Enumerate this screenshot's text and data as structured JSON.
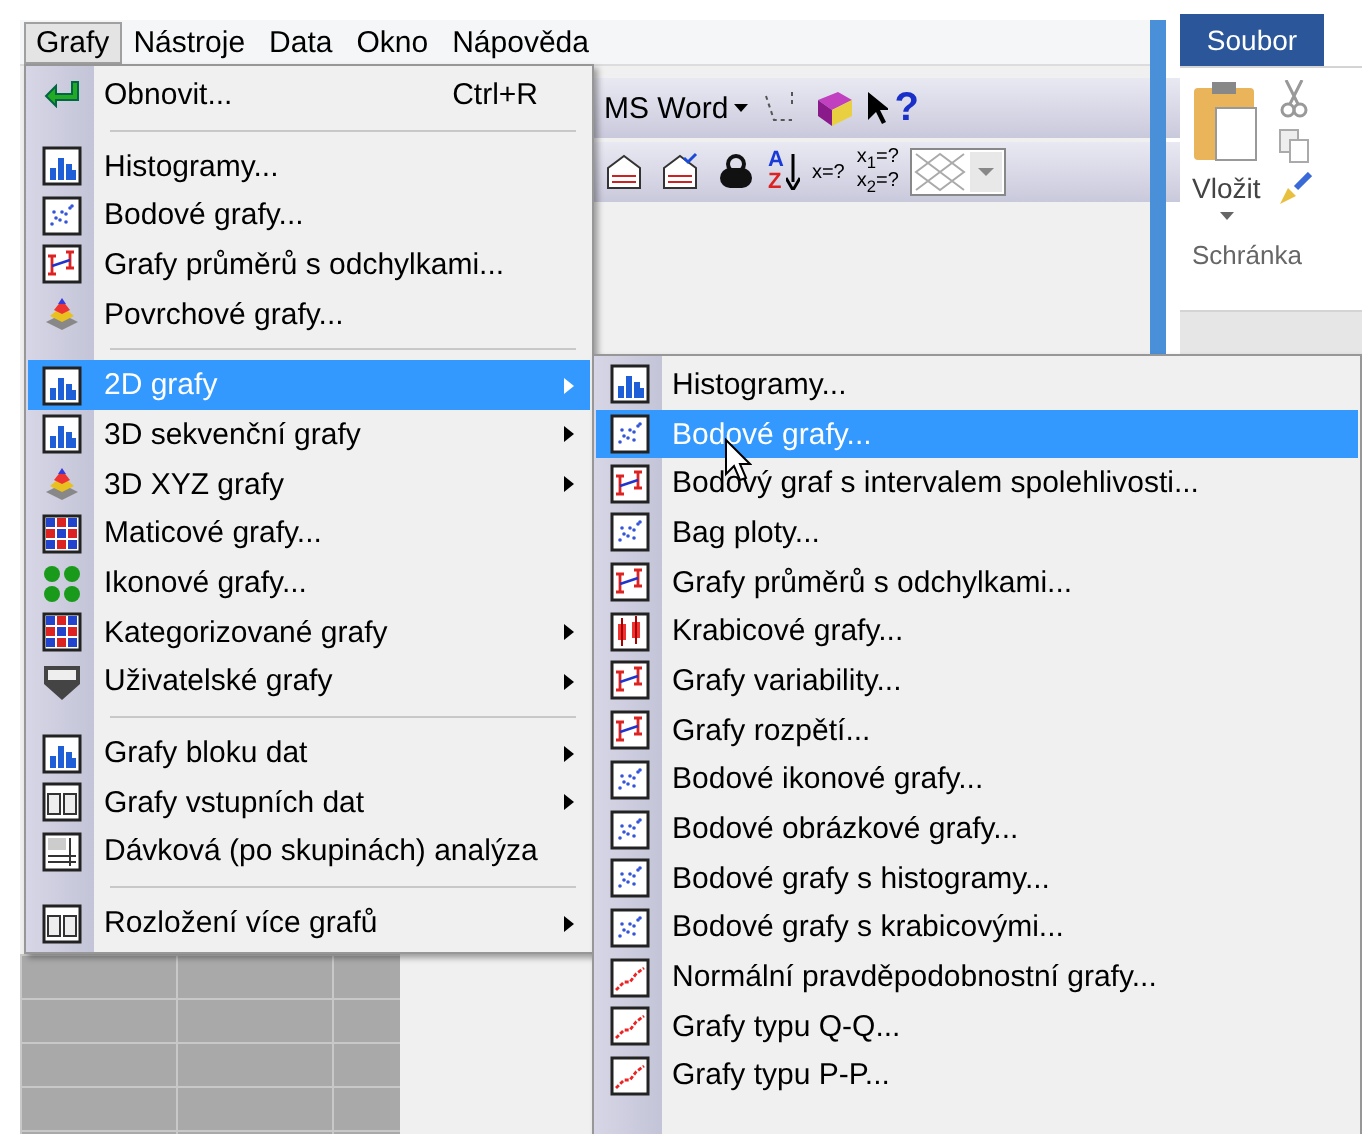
{
  "menubar": [
    {
      "label": "Grafy",
      "selected": true
    },
    {
      "label": "Nástroje",
      "selected": false
    },
    {
      "label": "Data",
      "selected": false
    },
    {
      "label": "Okno",
      "selected": false
    },
    {
      "label": "Nápověda",
      "selected": false
    }
  ],
  "toolbar": {
    "dropdown_label": "MS Word",
    "help_glyph": "?",
    "sort_letters": [
      "A",
      "Z"
    ],
    "formula_labels": [
      "x=?",
      "x$_{1}$=?",
      "x$_{2}$=?"
    ]
  },
  "ribbon": {
    "tab": "Soubor",
    "paste_label": "Vložit",
    "group_label": "Schránka"
  },
  "main_menu": [
    {
      "kind": "item",
      "label": "Obnovit...",
      "shortcut": "Ctrl+R",
      "submenu": false,
      "selected": false
    },
    {
      "kind": "separator"
    },
    {
      "kind": "item",
      "label": "Histogramy...",
      "submenu": false,
      "selected": false
    },
    {
      "kind": "item",
      "label": "Bodové grafy...",
      "submenu": false,
      "selected": false
    },
    {
      "kind": "item",
      "label": "Grafy průměrů s odchylkami...",
      "submenu": false,
      "selected": false
    },
    {
      "kind": "item",
      "label": "Povrchové grafy...",
      "submenu": false,
      "selected": false
    },
    {
      "kind": "separator"
    },
    {
      "kind": "item",
      "label": "2D grafy",
      "submenu": true,
      "selected": true
    },
    {
      "kind": "item",
      "label": "3D sekvenční grafy",
      "submenu": true,
      "selected": false
    },
    {
      "kind": "item",
      "label": "3D XYZ grafy",
      "submenu": true,
      "selected": false
    },
    {
      "kind": "item",
      "label": "Maticové grafy...",
      "submenu": false,
      "selected": false
    },
    {
      "kind": "item",
      "label": "Ikonové grafy...",
      "submenu": false,
      "selected": false
    },
    {
      "kind": "item",
      "label": "Kategorizované grafy",
      "submenu": true,
      "selected": false
    },
    {
      "kind": "item",
      "label": "Uživatelské grafy",
      "submenu": true,
      "selected": false
    },
    {
      "kind": "separator"
    },
    {
      "kind": "item",
      "label": "Grafy bloku dat",
      "submenu": true,
      "selected": false
    },
    {
      "kind": "item",
      "label": "Grafy vstupních dat",
      "submenu": true,
      "selected": false
    },
    {
      "kind": "item",
      "label": "Dávková (po skupinách) analýza",
      "submenu": false,
      "selected": false
    },
    {
      "kind": "separator"
    },
    {
      "kind": "item",
      "label": "Rozložení více grafů",
      "submenu": true,
      "selected": false
    }
  ],
  "submenu": [
    {
      "kind": "item",
      "label": "Histogramy...",
      "selected": false
    },
    {
      "kind": "item",
      "label": "Bodové grafy...",
      "selected": true
    },
    {
      "kind": "item",
      "label": "Bodový graf s intervalem spolehlivosti...",
      "selected": false
    },
    {
      "kind": "item",
      "label": "Bag ploty...",
      "selected": false
    },
    {
      "kind": "item",
      "label": "Grafy průměrů s odchylkami...",
      "selected": false
    },
    {
      "kind": "item",
      "label": "Krabicové grafy...",
      "selected": false
    },
    {
      "kind": "item",
      "label": "Grafy variability...",
      "selected": false
    },
    {
      "kind": "item",
      "label": "Grafy rozpětí...",
      "selected": false
    },
    {
      "kind": "item",
      "label": "Bodové ikonové grafy...",
      "selected": false
    },
    {
      "kind": "item",
      "label": "Bodové obrázkové grafy...",
      "selected": false
    },
    {
      "kind": "item",
      "label": "Bodové grafy s histogramy...",
      "selected": false
    },
    {
      "kind": "item",
      "label": "Bodové grafy s krabicovými...",
      "selected": false
    },
    {
      "kind": "item",
      "label": "Normální pravděpodobnostní grafy...",
      "selected": false
    },
    {
      "kind": "item",
      "label": "Grafy typu Q-Q...",
      "selected": false
    },
    {
      "kind": "item",
      "label": "Grafy typu P-P...",
      "selected": false
    }
  ]
}
